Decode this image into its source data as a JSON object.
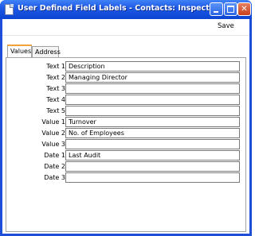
{
  "window": {
    "title": "User Defined Field Labels - Contacts: Inspect"
  },
  "toolbar": {
    "save_label": "Save"
  },
  "tabs": [
    {
      "label": "Values",
      "active": true
    },
    {
      "label": "Address",
      "active": false
    }
  ],
  "rows": [
    {
      "label": "Text 1",
      "value": "Description"
    },
    {
      "label": "Text 2",
      "value": "Managing Director"
    },
    {
      "label": "Text 3",
      "value": ""
    },
    {
      "label": "Text 4",
      "value": ""
    },
    {
      "label": "Text 5",
      "value": ""
    },
    {
      "label": "Value 1",
      "value": "Turnover"
    },
    {
      "label": "Value 2",
      "value": "No. of Employees"
    },
    {
      "label": "Value 3",
      "value": ""
    },
    {
      "label": "Date 1",
      "value": "Last Audit"
    },
    {
      "label": "Date 2",
      "value": ""
    },
    {
      "label": "Date 3",
      "value": ""
    }
  ]
}
